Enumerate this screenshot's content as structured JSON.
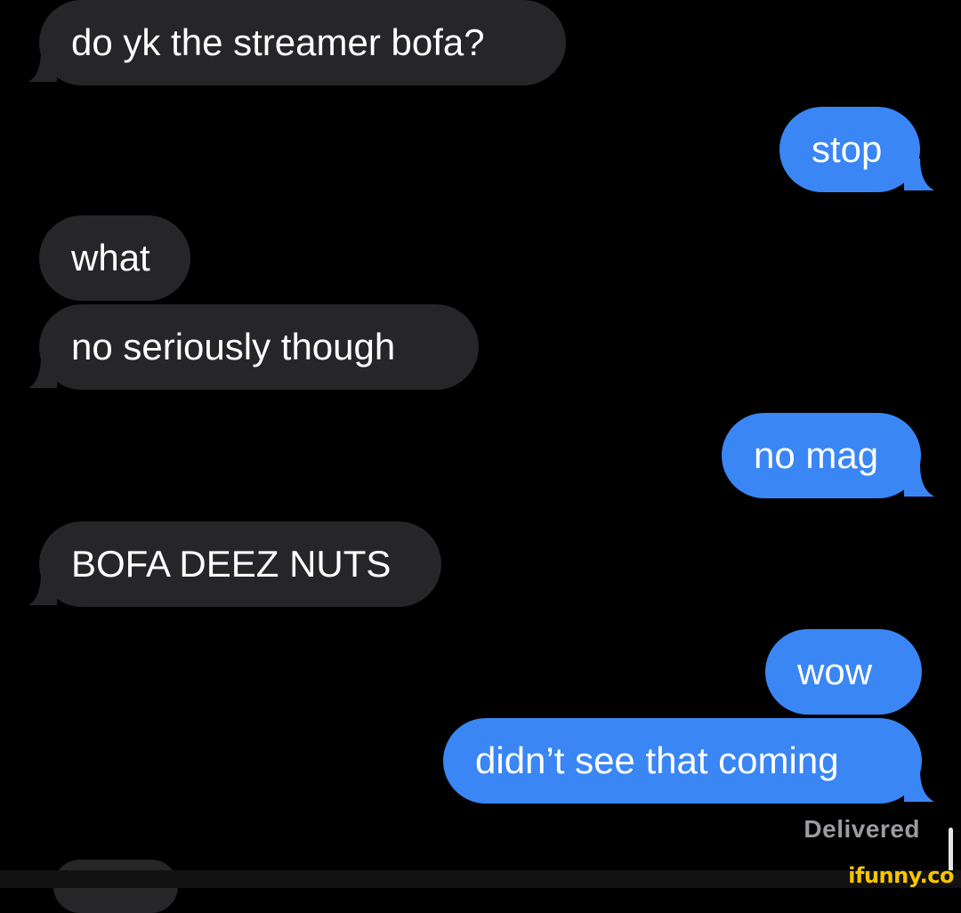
{
  "messages": [
    {
      "direction": "incoming",
      "text": "do yk the streamer bofa?"
    },
    {
      "direction": "outgoing",
      "text": "stop"
    },
    {
      "direction": "incoming",
      "text": "what"
    },
    {
      "direction": "incoming",
      "text": "no seriously though"
    },
    {
      "direction": "outgoing",
      "text": "no mag"
    },
    {
      "direction": "incoming",
      "text": "BOFA DEEZ NUTS"
    },
    {
      "direction": "outgoing",
      "text": "wow"
    },
    {
      "direction": "outgoing",
      "text": "didn’t see that coming"
    }
  ],
  "status": {
    "delivered_label": "Delivered"
  },
  "watermark": {
    "text": "ifunny.co"
  },
  "colors": {
    "background": "#000000",
    "incoming_bubble": "#262628",
    "outgoing_bubble": "#3a86f4",
    "delivered_text": "#9b9ba0",
    "watermark": "#f6c500"
  }
}
